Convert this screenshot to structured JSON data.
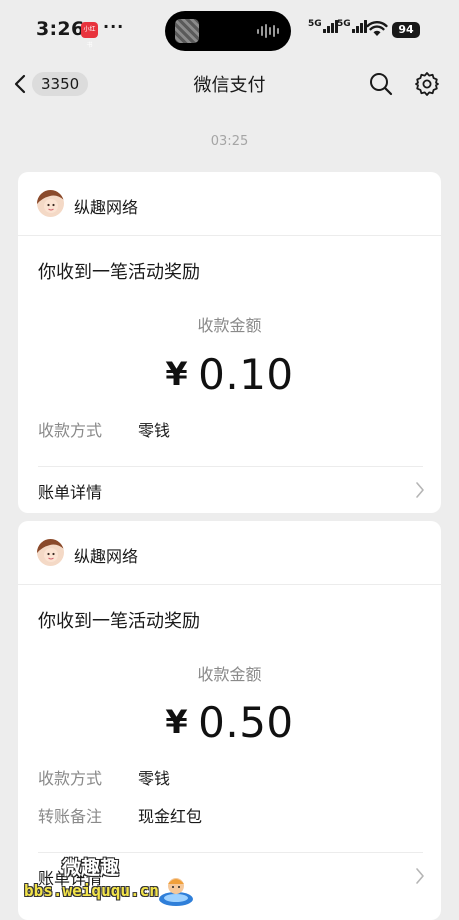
{
  "status_bar": {
    "time": "3:26",
    "notification_app": "小红书",
    "more_dots": "···",
    "network_1": "5G",
    "network_2": "5G",
    "battery": "94"
  },
  "nav": {
    "back_count": "3350",
    "title": "微信支付",
    "icons": [
      "chevron-left-icon",
      "search-icon",
      "gear-icon"
    ]
  },
  "timestamp": "03:25",
  "cards": [
    {
      "sender": "纵趣网络",
      "title": "你收到一笔活动奖励",
      "amount_label": "收款金额",
      "currency": "¥",
      "amount": "0.10",
      "rows": [
        {
          "key": "收款方式",
          "value": "零钱"
        }
      ],
      "detail_link": "账单详情"
    },
    {
      "sender": "纵趣网络",
      "title": "你收到一笔活动奖励",
      "amount_label": "收款金额",
      "currency": "¥",
      "amount": "0.50",
      "rows": [
        {
          "key": "收款方式",
          "value": "零钱"
        },
        {
          "key": "转账备注",
          "value": "现金红包"
        }
      ],
      "detail_link": "账单详情"
    }
  ],
  "watermark": {
    "title": "微趣趣",
    "url": "bbs.weiququ.cn"
  }
}
